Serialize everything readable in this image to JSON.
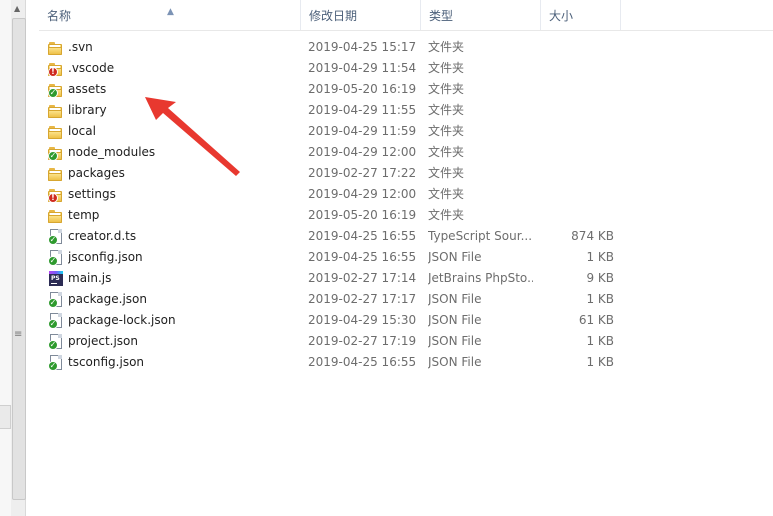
{
  "header": {
    "columns": [
      "名称",
      "修改日期",
      "类型",
      "大小"
    ]
  },
  "colors": {
    "header_text": "#4c607a",
    "annotation": "#e8382f",
    "status_ok": "#2e9a2e",
    "status_error": "#cf2b1f"
  },
  "files": [
    {
      "name": ".svn",
      "date": "2019-04-25 15:17",
      "type": "文件夹",
      "size": "",
      "icon": "folder-icon",
      "status": ""
    },
    {
      "name": ".vscode",
      "date": "2019-04-29 11:54",
      "type": "文件夹",
      "size": "",
      "icon": "folder-icon",
      "status": "error"
    },
    {
      "name": "assets",
      "date": "2019-05-20 16:19",
      "type": "文件夹",
      "size": "",
      "icon": "folder-icon",
      "status": "ok"
    },
    {
      "name": "library",
      "date": "2019-04-29 11:55",
      "type": "文件夹",
      "size": "",
      "icon": "folder-icon",
      "status": ""
    },
    {
      "name": "local",
      "date": "2019-04-29 11:59",
      "type": "文件夹",
      "size": "",
      "icon": "folder-icon",
      "status": ""
    },
    {
      "name": "node_modules",
      "date": "2019-04-29 12:00",
      "type": "文件夹",
      "size": "",
      "icon": "folder-icon",
      "status": "ok"
    },
    {
      "name": "packages",
      "date": "2019-02-27 17:22",
      "type": "文件夹",
      "size": "",
      "icon": "folder-icon",
      "status": ""
    },
    {
      "name": "settings",
      "date": "2019-04-29 12:00",
      "type": "文件夹",
      "size": "",
      "icon": "folder-icon",
      "status": "error"
    },
    {
      "name": "temp",
      "date": "2019-05-20 16:19",
      "type": "文件夹",
      "size": "",
      "icon": "folder-icon",
      "status": ""
    },
    {
      "name": "creator.d.ts",
      "date": "2019-04-25 16:55",
      "type": "TypeScript Sour...",
      "size": "874 KB",
      "icon": "document-icon",
      "status": "ok"
    },
    {
      "name": "jsconfig.json",
      "date": "2019-04-25 16:55",
      "type": "JSON File",
      "size": "1 KB",
      "icon": "document-icon",
      "status": "ok"
    },
    {
      "name": "main.js",
      "date": "2019-02-27 17:14",
      "type": "JetBrains PhpSto...",
      "size": "9 KB",
      "icon": "phpstorm-icon",
      "status": ""
    },
    {
      "name": "package.json",
      "date": "2019-02-27 17:17",
      "type": "JSON File",
      "size": "1 KB",
      "icon": "document-icon",
      "status": "ok"
    },
    {
      "name": "package-lock.json",
      "date": "2019-04-29 15:30",
      "type": "JSON File",
      "size": "61 KB",
      "icon": "document-icon",
      "status": "ok"
    },
    {
      "name": "project.json",
      "date": "2019-02-27 17:19",
      "type": "JSON File",
      "size": "1 KB",
      "icon": "document-icon",
      "status": "ok"
    },
    {
      "name": "tsconfig.json",
      "date": "2019-04-25 16:55",
      "type": "JSON File",
      "size": "1 KB",
      "icon": "document-icon",
      "status": "ok"
    }
  ]
}
